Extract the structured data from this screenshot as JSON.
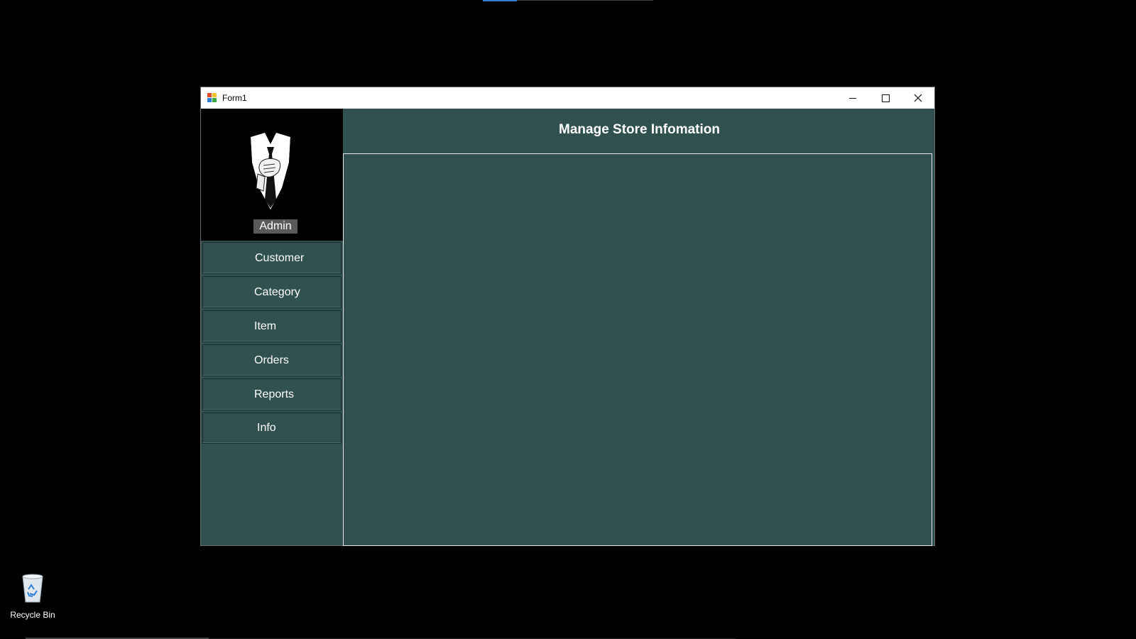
{
  "window": {
    "title": "Form1",
    "controls": {
      "minimize": "minimize-icon",
      "maximize": "maximize-icon",
      "close": "close-icon"
    }
  },
  "sidebar": {
    "user_label": "Admin",
    "items": [
      {
        "label": "Customer"
      },
      {
        "label": "Category"
      },
      {
        "label": "Item"
      },
      {
        "label": "Orders"
      },
      {
        "label": "Reports"
      },
      {
        "label": "Info"
      }
    ]
  },
  "main": {
    "header_title": "Manage Store Infomation"
  },
  "desktop": {
    "icons": [
      {
        "label": "Recycle Bin",
        "icon": "recycle-bin-icon"
      }
    ]
  },
  "colors": {
    "panel_bg": "#315050",
    "profile_bg": "#000000",
    "admin_badge_bg": "#5a5a5a",
    "text": "#ffffff"
  }
}
